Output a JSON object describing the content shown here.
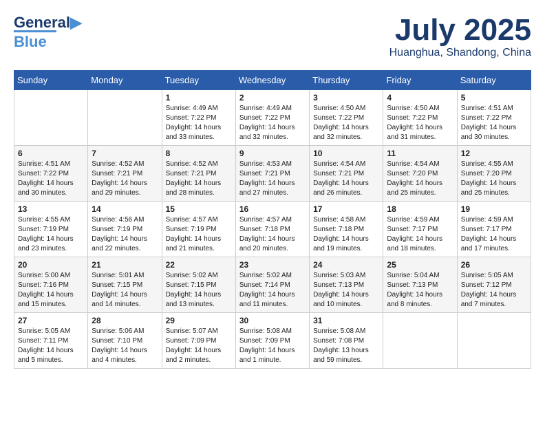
{
  "header": {
    "logo": {
      "line1": "General",
      "line2": "Blue"
    },
    "title": "July 2025",
    "subtitle": "Huanghua, Shandong, China"
  },
  "weekdays": [
    "Sunday",
    "Monday",
    "Tuesday",
    "Wednesday",
    "Thursday",
    "Friday",
    "Saturday"
  ],
  "weeks": [
    [
      {
        "day": "",
        "sunrise": "",
        "sunset": "",
        "daylight": ""
      },
      {
        "day": "",
        "sunrise": "",
        "sunset": "",
        "daylight": ""
      },
      {
        "day": "1",
        "sunrise": "Sunrise: 4:49 AM",
        "sunset": "Sunset: 7:22 PM",
        "daylight": "Daylight: 14 hours and 33 minutes."
      },
      {
        "day": "2",
        "sunrise": "Sunrise: 4:49 AM",
        "sunset": "Sunset: 7:22 PM",
        "daylight": "Daylight: 14 hours and 32 minutes."
      },
      {
        "day": "3",
        "sunrise": "Sunrise: 4:50 AM",
        "sunset": "Sunset: 7:22 PM",
        "daylight": "Daylight: 14 hours and 32 minutes."
      },
      {
        "day": "4",
        "sunrise": "Sunrise: 4:50 AM",
        "sunset": "Sunset: 7:22 PM",
        "daylight": "Daylight: 14 hours and 31 minutes."
      },
      {
        "day": "5",
        "sunrise": "Sunrise: 4:51 AM",
        "sunset": "Sunset: 7:22 PM",
        "daylight": "Daylight: 14 hours and 30 minutes."
      }
    ],
    [
      {
        "day": "6",
        "sunrise": "Sunrise: 4:51 AM",
        "sunset": "Sunset: 7:22 PM",
        "daylight": "Daylight: 14 hours and 30 minutes."
      },
      {
        "day": "7",
        "sunrise": "Sunrise: 4:52 AM",
        "sunset": "Sunset: 7:21 PM",
        "daylight": "Daylight: 14 hours and 29 minutes."
      },
      {
        "day": "8",
        "sunrise": "Sunrise: 4:52 AM",
        "sunset": "Sunset: 7:21 PM",
        "daylight": "Daylight: 14 hours and 28 minutes."
      },
      {
        "day": "9",
        "sunrise": "Sunrise: 4:53 AM",
        "sunset": "Sunset: 7:21 PM",
        "daylight": "Daylight: 14 hours and 27 minutes."
      },
      {
        "day": "10",
        "sunrise": "Sunrise: 4:54 AM",
        "sunset": "Sunset: 7:21 PM",
        "daylight": "Daylight: 14 hours and 26 minutes."
      },
      {
        "day": "11",
        "sunrise": "Sunrise: 4:54 AM",
        "sunset": "Sunset: 7:20 PM",
        "daylight": "Daylight: 14 hours and 25 minutes."
      },
      {
        "day": "12",
        "sunrise": "Sunrise: 4:55 AM",
        "sunset": "Sunset: 7:20 PM",
        "daylight": "Daylight: 14 hours and 25 minutes."
      }
    ],
    [
      {
        "day": "13",
        "sunrise": "Sunrise: 4:55 AM",
        "sunset": "Sunset: 7:19 PM",
        "daylight": "Daylight: 14 hours and 23 minutes."
      },
      {
        "day": "14",
        "sunrise": "Sunrise: 4:56 AM",
        "sunset": "Sunset: 7:19 PM",
        "daylight": "Daylight: 14 hours and 22 minutes."
      },
      {
        "day": "15",
        "sunrise": "Sunrise: 4:57 AM",
        "sunset": "Sunset: 7:19 PM",
        "daylight": "Daylight: 14 hours and 21 minutes."
      },
      {
        "day": "16",
        "sunrise": "Sunrise: 4:57 AM",
        "sunset": "Sunset: 7:18 PM",
        "daylight": "Daylight: 14 hours and 20 minutes."
      },
      {
        "day": "17",
        "sunrise": "Sunrise: 4:58 AM",
        "sunset": "Sunset: 7:18 PM",
        "daylight": "Daylight: 14 hours and 19 minutes."
      },
      {
        "day": "18",
        "sunrise": "Sunrise: 4:59 AM",
        "sunset": "Sunset: 7:17 PM",
        "daylight": "Daylight: 14 hours and 18 minutes."
      },
      {
        "day": "19",
        "sunrise": "Sunrise: 4:59 AM",
        "sunset": "Sunset: 7:17 PM",
        "daylight": "Daylight: 14 hours and 17 minutes."
      }
    ],
    [
      {
        "day": "20",
        "sunrise": "Sunrise: 5:00 AM",
        "sunset": "Sunset: 7:16 PM",
        "daylight": "Daylight: 14 hours and 15 minutes."
      },
      {
        "day": "21",
        "sunrise": "Sunrise: 5:01 AM",
        "sunset": "Sunset: 7:15 PM",
        "daylight": "Daylight: 14 hours and 14 minutes."
      },
      {
        "day": "22",
        "sunrise": "Sunrise: 5:02 AM",
        "sunset": "Sunset: 7:15 PM",
        "daylight": "Daylight: 14 hours and 13 minutes."
      },
      {
        "day": "23",
        "sunrise": "Sunrise: 5:02 AM",
        "sunset": "Sunset: 7:14 PM",
        "daylight": "Daylight: 14 hours and 11 minutes."
      },
      {
        "day": "24",
        "sunrise": "Sunrise: 5:03 AM",
        "sunset": "Sunset: 7:13 PM",
        "daylight": "Daylight: 14 hours and 10 minutes."
      },
      {
        "day": "25",
        "sunrise": "Sunrise: 5:04 AM",
        "sunset": "Sunset: 7:13 PM",
        "daylight": "Daylight: 14 hours and 8 minutes."
      },
      {
        "day": "26",
        "sunrise": "Sunrise: 5:05 AM",
        "sunset": "Sunset: 7:12 PM",
        "daylight": "Daylight: 14 hours and 7 minutes."
      }
    ],
    [
      {
        "day": "27",
        "sunrise": "Sunrise: 5:05 AM",
        "sunset": "Sunset: 7:11 PM",
        "daylight": "Daylight: 14 hours and 5 minutes."
      },
      {
        "day": "28",
        "sunrise": "Sunrise: 5:06 AM",
        "sunset": "Sunset: 7:10 PM",
        "daylight": "Daylight: 14 hours and 4 minutes."
      },
      {
        "day": "29",
        "sunrise": "Sunrise: 5:07 AM",
        "sunset": "Sunset: 7:09 PM",
        "daylight": "Daylight: 14 hours and 2 minutes."
      },
      {
        "day": "30",
        "sunrise": "Sunrise: 5:08 AM",
        "sunset": "Sunset: 7:09 PM",
        "daylight": "Daylight: 14 hours and 1 minute."
      },
      {
        "day": "31",
        "sunrise": "Sunrise: 5:08 AM",
        "sunset": "Sunset: 7:08 PM",
        "daylight": "Daylight: 13 hours and 59 minutes."
      },
      {
        "day": "",
        "sunrise": "",
        "sunset": "",
        "daylight": ""
      },
      {
        "day": "",
        "sunrise": "",
        "sunset": "",
        "daylight": ""
      }
    ]
  ]
}
